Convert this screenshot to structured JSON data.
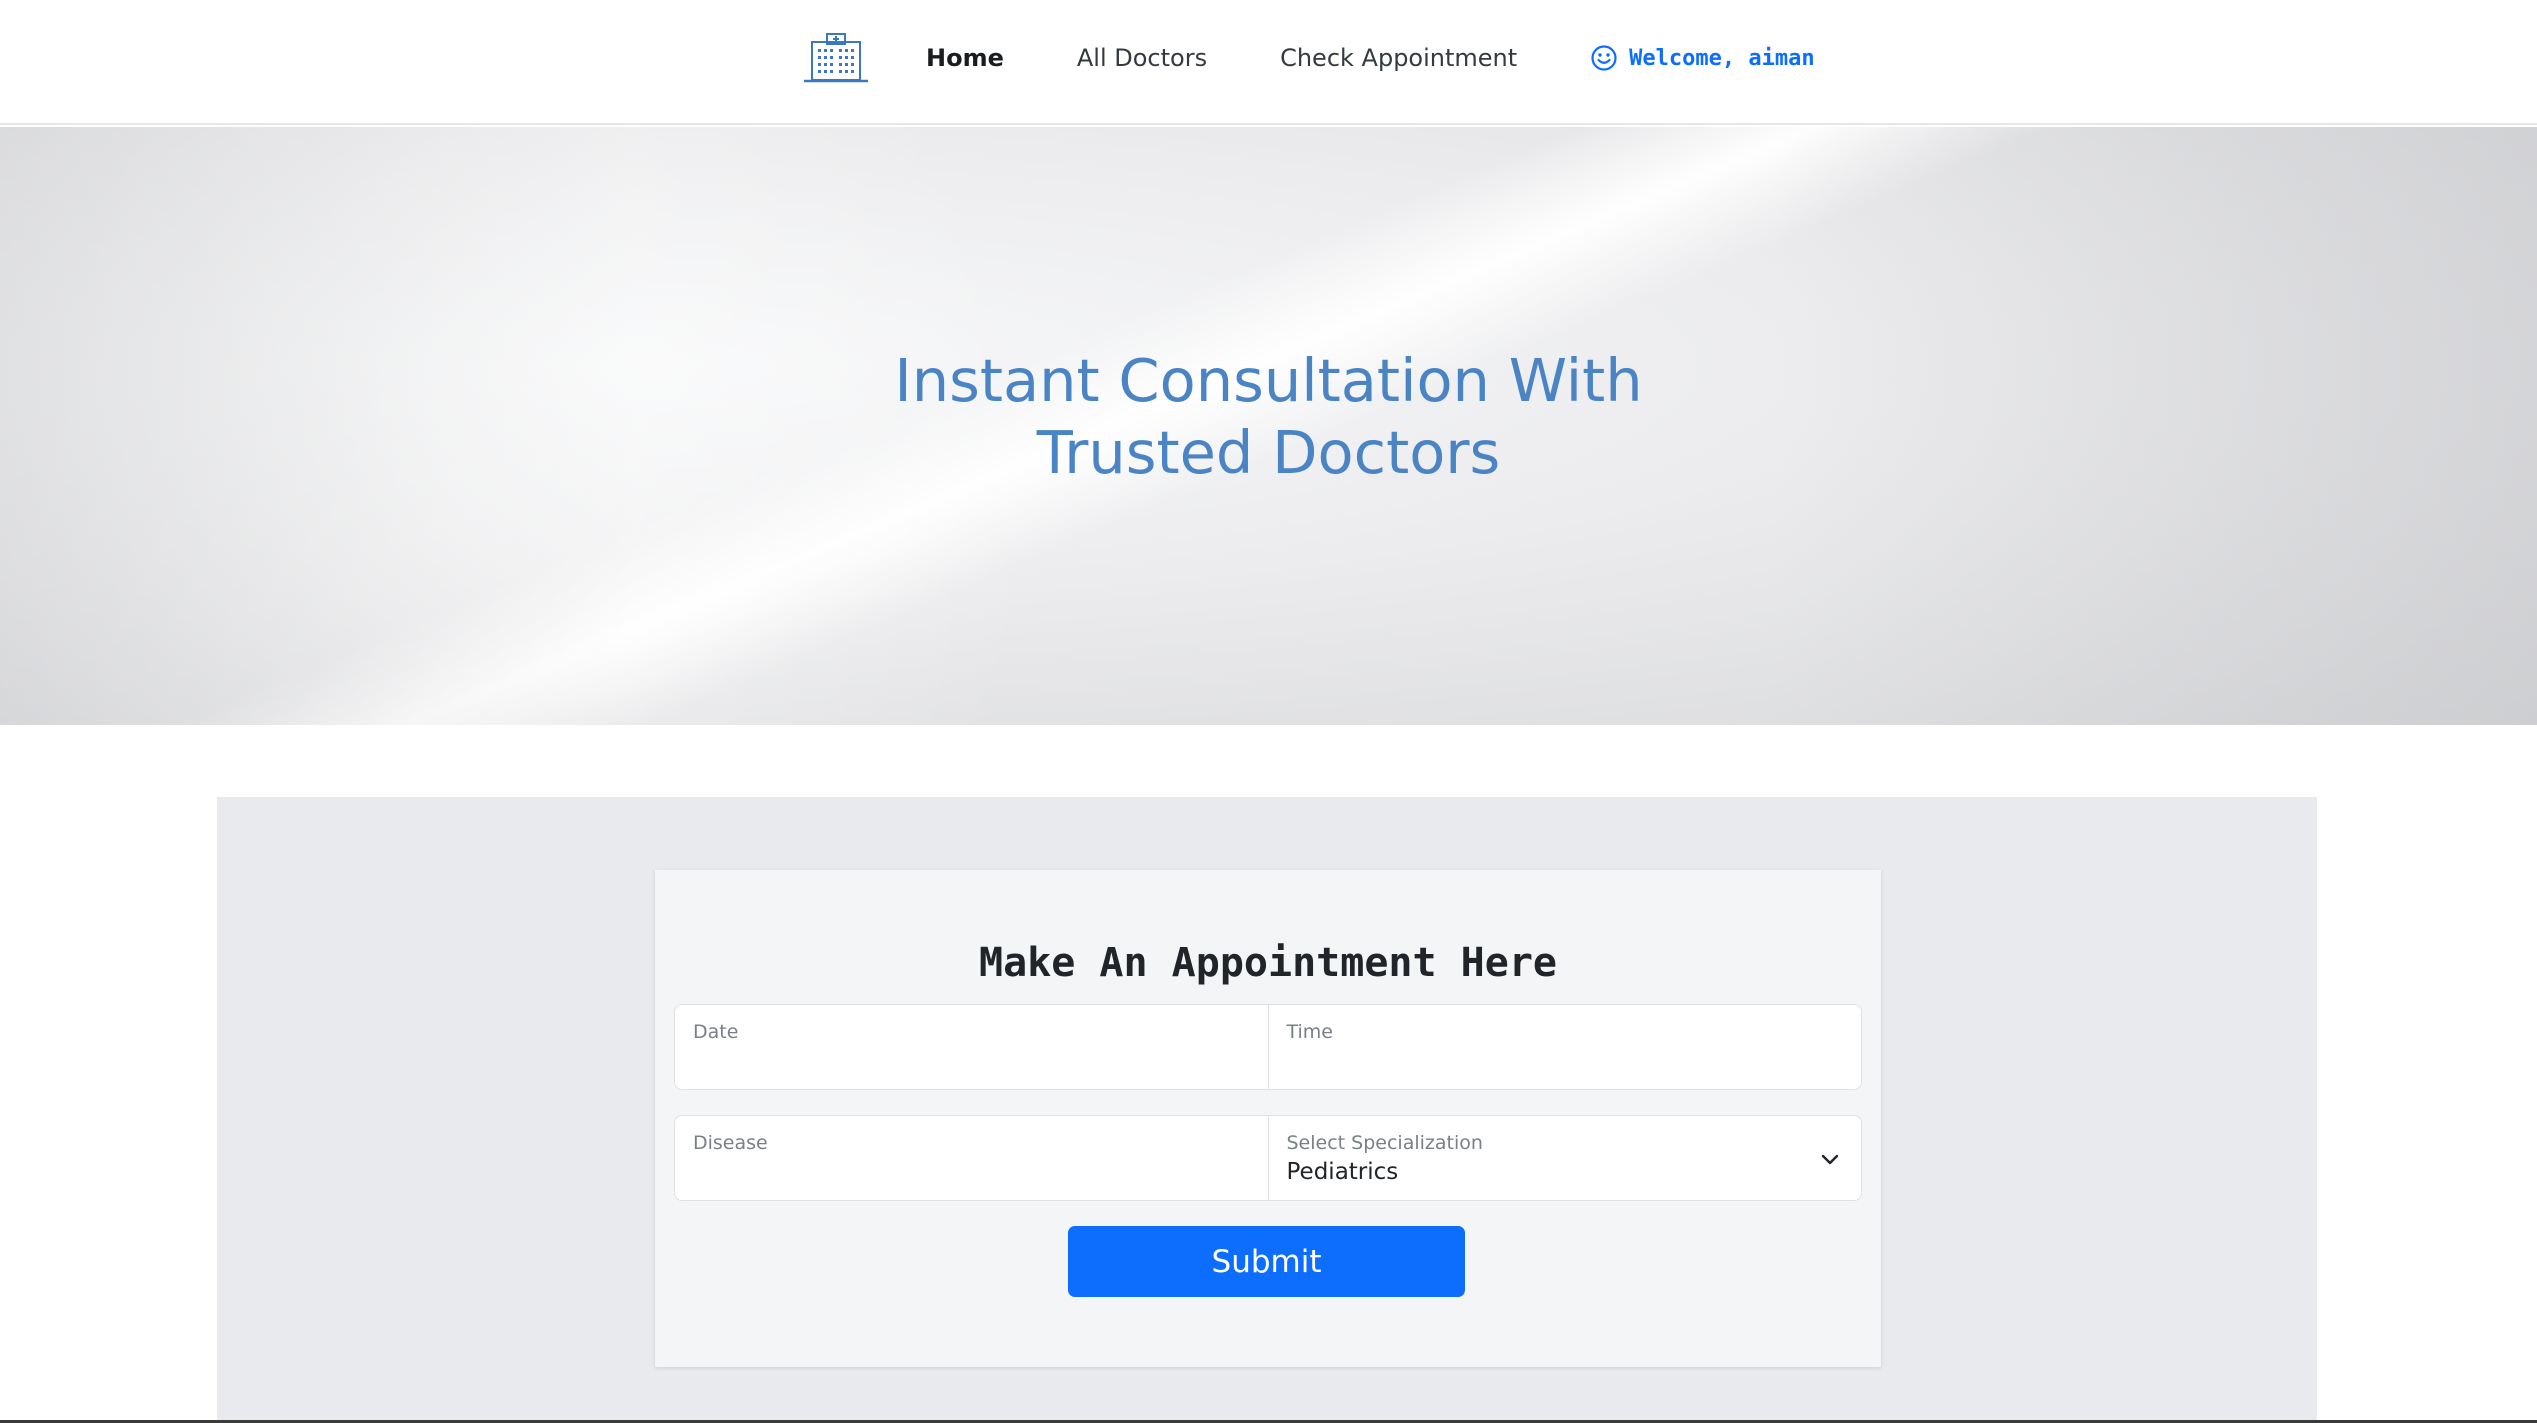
{
  "nav": {
    "logo_icon": "hospital-icon",
    "links": [
      {
        "label": "Home",
        "active": true
      },
      {
        "label": "All Doctors",
        "active": false
      },
      {
        "label": "Check Appointment",
        "active": false
      }
    ],
    "welcome_icon": "smile-icon",
    "welcome_text": "Welcome, aiman"
  },
  "hero": {
    "title_line1": "Instant Consultation With",
    "title_line2": "Trusted Doctors"
  },
  "form": {
    "title": "Make An Appointment Here",
    "date_label": "Date",
    "date_value": "",
    "time_label": "Time",
    "time_value": "",
    "disease_label": "Disease",
    "disease_value": "",
    "specialization_label": "Select Specialization",
    "specialization_value": "Pediatrics",
    "submit_label": "Submit"
  },
  "colors": {
    "accent": "#0d6efd",
    "hero_title": "#4a84c4",
    "section_bg": "#e8eaed"
  }
}
